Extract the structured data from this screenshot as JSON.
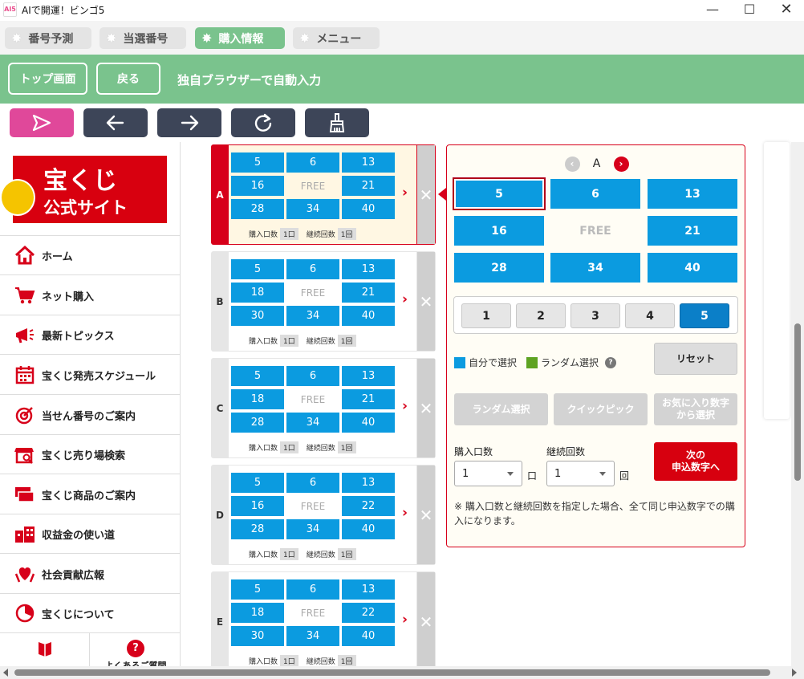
{
  "window": {
    "title": "AIで開運！ビンゴ5",
    "logo_text": "AI5"
  },
  "tabs": [
    {
      "label": "番号予測"
    },
    {
      "label": "当選番号"
    },
    {
      "label": "購入情報"
    },
    {
      "label": "メニュー"
    }
  ],
  "header": {
    "top_button": "トップ画面",
    "back_button": "戻る",
    "title": "独自ブラウザーで自動入力"
  },
  "sidebar": {
    "logo_line1": "宝くじ",
    "logo_line2": "公式サイト",
    "items": [
      {
        "label": "ホーム"
      },
      {
        "label": "ネット購入"
      },
      {
        "label": "最新トピックス"
      },
      {
        "label": "宝くじ発売スケジュール"
      },
      {
        "label": "当せん番号のご案内"
      },
      {
        "label": "宝くじ売り場検索"
      },
      {
        "label": "宝くじ商品のご案内"
      },
      {
        "label": "収益金の使い道"
      },
      {
        "label": "社会貢献広報"
      },
      {
        "label": "宝くじについて"
      }
    ],
    "bottom_label": "よくあるご質問"
  },
  "cards": [
    {
      "letter": "A",
      "rows": [
        [
          "5",
          "6",
          "13"
        ],
        [
          "16",
          "FREE",
          "21"
        ],
        [
          "28",
          "34",
          "40"
        ]
      ],
      "kuchi_label": "購入口数",
      "kuchi": "1口",
      "kaisu_label": "継続回数",
      "kaisu": "1回"
    },
    {
      "letter": "B",
      "rows": [
        [
          "5",
          "6",
          "13"
        ],
        [
          "18",
          "FREE",
          "21"
        ],
        [
          "30",
          "34",
          "40"
        ]
      ],
      "kuchi_label": "購入口数",
      "kuchi": "1口",
      "kaisu_label": "継続回数",
      "kaisu": "1回"
    },
    {
      "letter": "C",
      "rows": [
        [
          "5",
          "6",
          "13"
        ],
        [
          "18",
          "FREE",
          "21"
        ],
        [
          "28",
          "34",
          "40"
        ]
      ],
      "kuchi_label": "購入口数",
      "kuchi": "1口",
      "kaisu_label": "継続回数",
      "kaisu": "1回"
    },
    {
      "letter": "D",
      "rows": [
        [
          "5",
          "6",
          "13"
        ],
        [
          "16",
          "FREE",
          "22"
        ],
        [
          "28",
          "34",
          "40"
        ]
      ],
      "kuchi_label": "購入口数",
      "kuchi": "1口",
      "kaisu_label": "継続回数",
      "kaisu": "1回"
    },
    {
      "letter": "E",
      "rows": [
        [
          "5",
          "6",
          "13"
        ],
        [
          "18",
          "FREE",
          "22"
        ],
        [
          "30",
          "34",
          "40"
        ]
      ],
      "kuchi_label": "購入口数",
      "kuchi": "1口",
      "kaisu_label": "継続回数",
      "kaisu": "1回"
    }
  ],
  "panel": {
    "current": "A",
    "grid": [
      [
        "5",
        "6",
        "13"
      ],
      [
        "16",
        "FREE",
        "21"
      ],
      [
        "28",
        "34",
        "40"
      ]
    ],
    "numbers": [
      "1",
      "2",
      "3",
      "4",
      "5"
    ],
    "legend_self": "自分で選択",
    "legend_random": "ランダム選択",
    "help": "?",
    "reset": "リセット",
    "random_btn": "ランダム選択",
    "quick_btn": "クイックピック",
    "fav_btn_l1": "お気に入り数字",
    "fav_btn_l2": "から選択",
    "kuchi_label": "購入口数",
    "kaisu_label": "継続回数",
    "kuchi_value": "1",
    "kaisu_value": "1",
    "kuchi_unit": "口",
    "kaisu_unit": "回",
    "next_l1": "次の",
    "next_l2": "申込数字へ",
    "note": "※ 購入口数と継続回数を指定した場合、全て同じ申込数字での購入になります。"
  },
  "colors": {
    "green": "#7ac38d",
    "blue": "#0b9be0",
    "red": "#d7001a",
    "navy": "#3d4558",
    "pink": "#e0489a"
  }
}
